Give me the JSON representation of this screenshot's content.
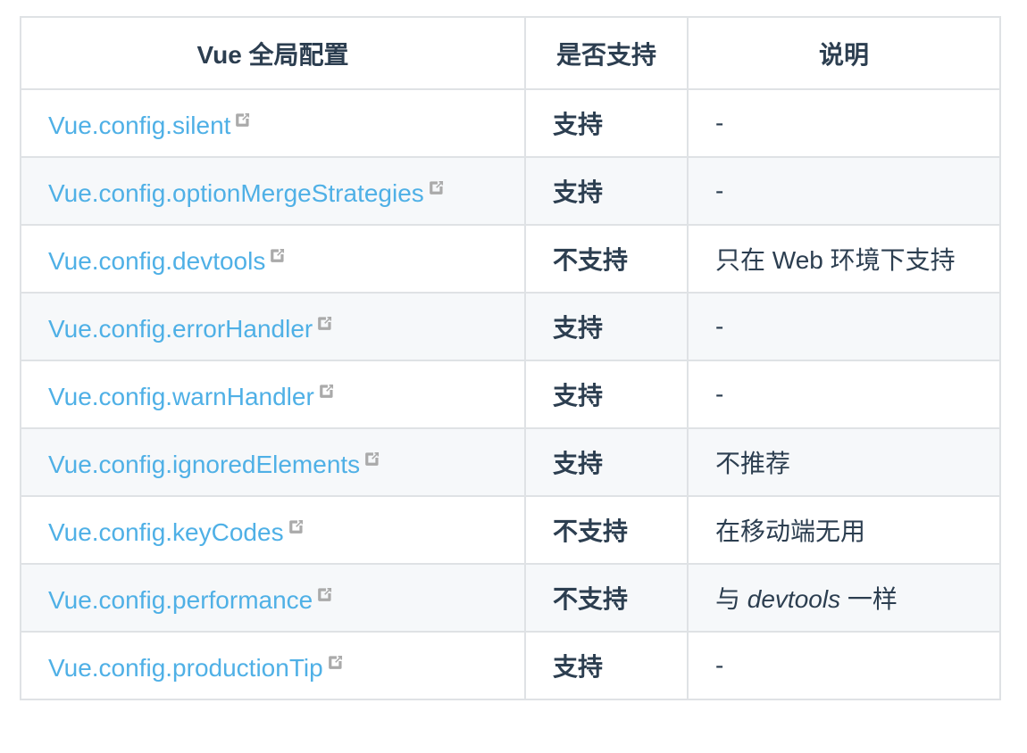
{
  "table": {
    "headers": [
      "Vue 全局配置",
      "是否支持",
      "说明"
    ],
    "rows": [
      {
        "config": "Vue.config.silent",
        "support": "支持",
        "note_pre": "-",
        "note_em": "",
        "note_post": ""
      },
      {
        "config": "Vue.config.optionMergeStrategies",
        "support": "支持",
        "note_pre": "-",
        "note_em": "",
        "note_post": ""
      },
      {
        "config": "Vue.config.devtools",
        "support": "不支持",
        "note_pre": "只在 Web 环境下支持",
        "note_em": "",
        "note_post": ""
      },
      {
        "config": "Vue.config.errorHandler",
        "support": "支持",
        "note_pre": "-",
        "note_em": "",
        "note_post": ""
      },
      {
        "config": "Vue.config.warnHandler",
        "support": "支持",
        "note_pre": "-",
        "note_em": "",
        "note_post": ""
      },
      {
        "config": "Vue.config.ignoredElements",
        "support": "支持",
        "note_pre": "不推荐",
        "note_em": "",
        "note_post": ""
      },
      {
        "config": "Vue.config.keyCodes",
        "support": "不支持",
        "note_pre": "在移动端无用",
        "note_em": "",
        "note_post": ""
      },
      {
        "config": "Vue.config.performance",
        "support": "不支持",
        "note_pre": "与 ",
        "note_em": "devtools",
        "note_post": " 一样"
      },
      {
        "config": "Vue.config.productionTip",
        "support": "支持",
        "note_pre": "-",
        "note_em": "",
        "note_post": ""
      }
    ]
  },
  "icons": {
    "external_link": "external-link-icon"
  },
  "colors": {
    "link": "#4fb0e6",
    "border": "#dfe2e5",
    "stripe": "#f6f8fa",
    "text": "#2c3e50",
    "icon": "#aaaaaa"
  }
}
